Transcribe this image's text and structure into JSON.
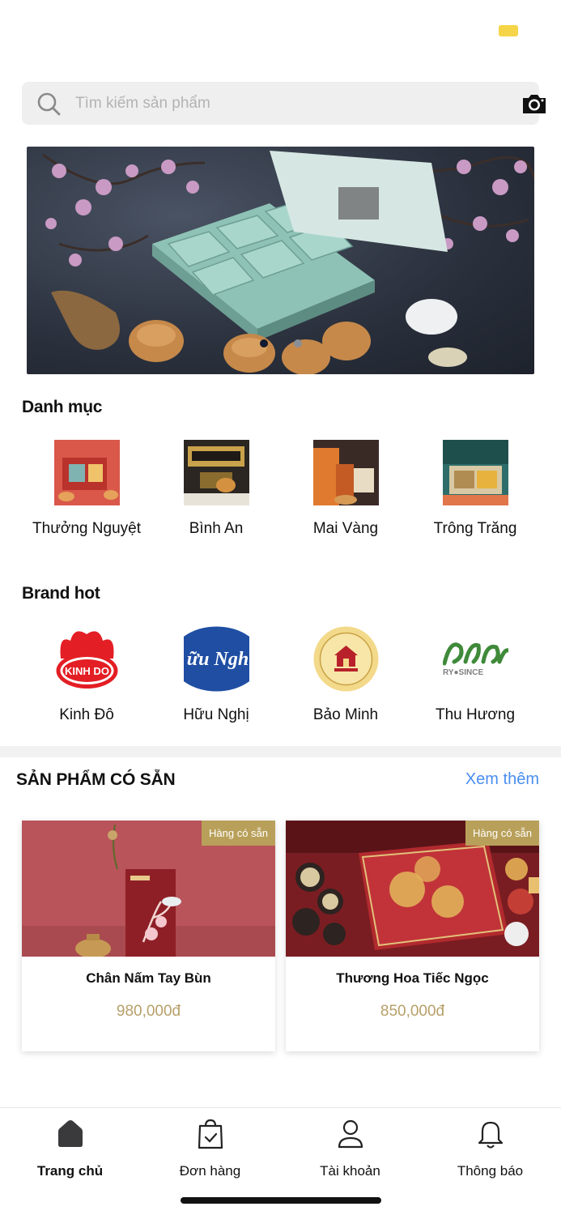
{
  "search": {
    "placeholder": "Tìm kiếm sản phẩm",
    "value": ""
  },
  "banner": {
    "slides": 2,
    "active_slide": 1
  },
  "categories": {
    "title": "Danh mục",
    "items": [
      {
        "label": "Thưởng Nguyệt"
      },
      {
        "label": "Bình An"
      },
      {
        "label": "Mai Vàng"
      },
      {
        "label": "Trông Trăng"
      }
    ]
  },
  "brands": {
    "title": "Brand hot",
    "items": [
      {
        "label": "Kinh Đô",
        "logo_text": "KINH DO"
      },
      {
        "label": "Hữu Nghị",
        "logo_text": "ữu Ngh"
      },
      {
        "label": "Bảo Minh"
      },
      {
        "label": "Thu Hương",
        "logo_text": "RY●SINCE"
      }
    ]
  },
  "available": {
    "title": "SẢN PHẨM CÓ SẴN",
    "see_more": "Xem thêm",
    "products": [
      {
        "name": "Chân Nấm Tay Bùn",
        "price": "980,000đ",
        "badge": "Hàng có sẵn"
      },
      {
        "name": "Thương Hoa Tiếc Ngọc",
        "price": "850,000đ",
        "badge": "Hàng có sẵn"
      }
    ]
  },
  "nav": {
    "items": [
      {
        "label": "Trang chủ",
        "icon": "home-icon",
        "active": true
      },
      {
        "label": "Đơn hàng",
        "icon": "shopping-bag-icon",
        "active": false
      },
      {
        "label": "Tài khoản",
        "icon": "user-icon",
        "active": false
      },
      {
        "label": "Thông báo",
        "icon": "bell-icon",
        "active": false
      }
    ]
  },
  "colors": {
    "accent_link": "#4a8ef0",
    "price": "#b7a068",
    "badge": "#b9a05a",
    "status_pill": "#f5d547"
  }
}
